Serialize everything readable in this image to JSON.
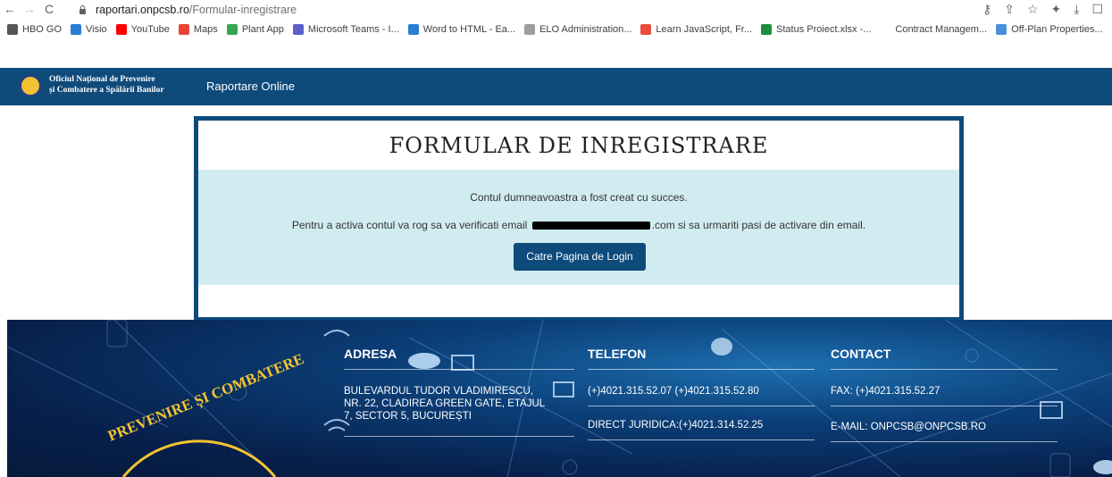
{
  "browser": {
    "url_host": "raportari.onpcsb.ro",
    "url_path": "/Formular-inregistrare",
    "bookmarks": [
      {
        "label": "HBO GO",
        "color": "#555555"
      },
      {
        "label": "Visio",
        "color": "#2b7cd3"
      },
      {
        "label": "YouTube",
        "color": "#ff0000"
      },
      {
        "label": "Maps",
        "color": "#ea4335"
      },
      {
        "label": "Plant App",
        "color": "#34a853"
      },
      {
        "label": "Microsoft Teams - I...",
        "color": "#5b5fc7"
      },
      {
        "label": "Word to HTML - Ea...",
        "color": "#2b7cd3"
      },
      {
        "label": "ELO Administration...",
        "color": "#9e9e9e"
      },
      {
        "label": "Learn JavaScript, Fr...",
        "color": "#e94e3c"
      },
      {
        "label": "Status Proiect.xlsx -...",
        "color": "#1e8e3e"
      },
      {
        "label": "Contract Managem...",
        "color": "#ffffff"
      },
      {
        "label": "Off-Plan Properties...",
        "color": "#4a90d9"
      }
    ]
  },
  "header": {
    "logo_line1": "Oficiul Național de Prevenire",
    "logo_line2": "și Combatere a Spălării Banilor",
    "nav_link": "Raportare Online"
  },
  "form": {
    "title": "FORMULAR DE INREGISTRARE",
    "message1": "Contul dumneavoastra a fost creat cu succes.",
    "message2_before": "Pentru a activa contul va rog sa va verificati email",
    "message2_after": ".com si sa urmariti pasi de activare din email.",
    "login_button": "Catre Pagina de Login"
  },
  "footer": {
    "address_title": "ADRESA",
    "address_line1": "BULEVARDUL TUDOR VLADIMIRESCU,",
    "address_line2": "NR. 22, CLADIREA GREEN GATE, ETAJUL",
    "address_line3": "7, SECTOR 5, BUCUREȘTI",
    "phone_title": "TELEFON",
    "phone_line1": "(+)4021.315.52.07 (+)4021.315.52.80",
    "phone_line2": "DIRECT JURIDICA:(+)4021.314.52.25",
    "contact_title": "CONTACT",
    "fax": "FAX: (+)4021.315.52.27",
    "email": "E-MAIL: ONPCSB@ONPCSB.RO",
    "seal_text": "PREVENIRE ȘI COMBATERE"
  },
  "colors": {
    "brand_blue": "#0e4a7a",
    "alert_bg": "#d1ecf1"
  }
}
